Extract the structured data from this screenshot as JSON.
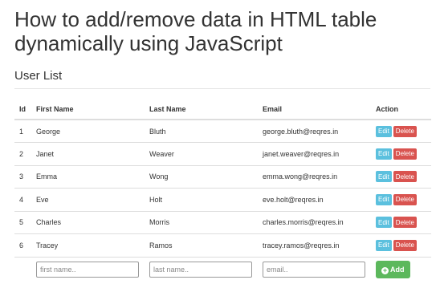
{
  "page": {
    "title": "How to add/remove data in HTML table dynamically using JavaScript",
    "subtitle": "User List"
  },
  "table": {
    "headers": {
      "id": "Id",
      "first_name": "First Name",
      "last_name": "Last Name",
      "email": "Email",
      "action": "Action"
    },
    "rows": [
      {
        "id": "1",
        "first_name": "George",
        "last_name": "Bluth",
        "email": "george.bluth@reqres.in"
      },
      {
        "id": "2",
        "first_name": "Janet",
        "last_name": "Weaver",
        "email": "janet.weaver@reqres.in"
      },
      {
        "id": "3",
        "first_name": "Emma",
        "last_name": "Wong",
        "email": "emma.wong@reqres.in"
      },
      {
        "id": "4",
        "first_name": "Eve",
        "last_name": "Holt",
        "email": "eve.holt@reqres.in"
      },
      {
        "id": "5",
        "first_name": "Charles",
        "last_name": "Morris",
        "email": "charles.morris@reqres.in"
      },
      {
        "id": "6",
        "first_name": "Tracey",
        "last_name": "Ramos",
        "email": "tracey.ramos@reqres.in"
      }
    ],
    "edit_label": "Edit",
    "delete_label": "Delete"
  },
  "form": {
    "first_name_placeholder": "first name..",
    "last_name_placeholder": "last name..",
    "email_placeholder": "email..",
    "first_name_value": "",
    "last_name_value": "",
    "email_value": "",
    "add_label": "Add",
    "add_icon": "plus-circle-icon"
  },
  "colors": {
    "edit": "#5bc0de",
    "delete": "#d9534f",
    "add": "#5cb85c"
  }
}
